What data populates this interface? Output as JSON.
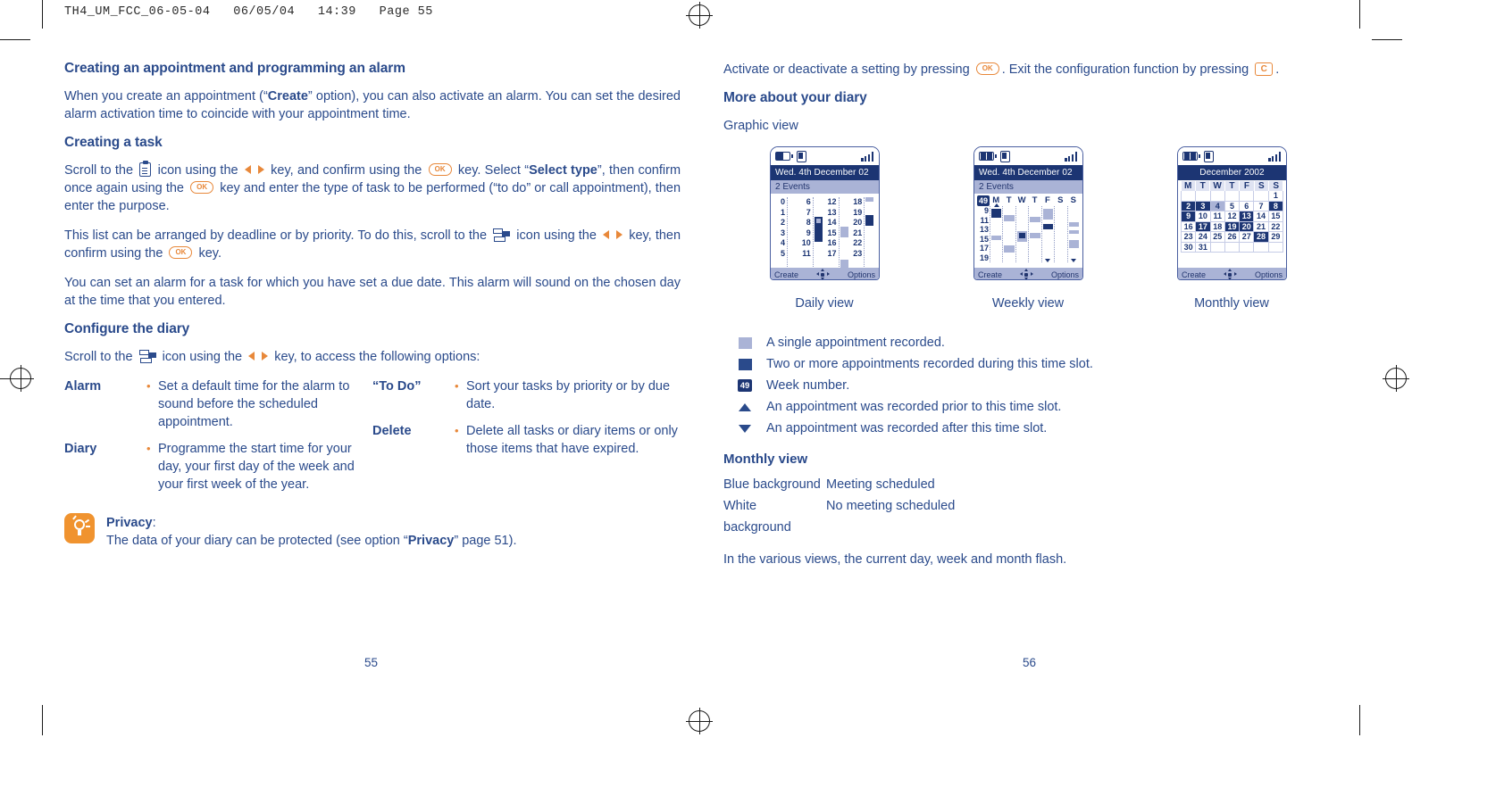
{
  "document_header": "TH4_UM_FCC_06-05-04   06/05/04   14:39   Page 55",
  "colors": {
    "text_blue": "#2a4a8b",
    "accent_orange": "#e8883a",
    "screen_dark": "#1c3573",
    "screen_light": "#aab3d6"
  },
  "left_column": {
    "heading1": "Creating an appointment and programming an alarm",
    "para1_a": "When you create an appointment (“",
    "para1_b": "Create",
    "para1_c": "” option), you can also activate an alarm. You can set the desired alarm activation time to coincide with your appointment time.",
    "heading2": "Creating a task",
    "para2_a": "Scroll to the",
    "para2_b": "icon using the",
    "para2_c": "key, and confirm using the",
    "para2_d": "key. Select “",
    "para2_e": "Select type",
    "para2_f": "”, then confirm once again using the",
    "para2_g": "key and enter the type of task to be performed (“to do” or call appointment), then enter the purpose.",
    "para3_a": "This list can be arranged by deadline or by priority. To do this, scroll to the",
    "para3_b": "icon using the",
    "para3_c": "key, then confirm using the",
    "para3_d": "key.",
    "para4": "You can set an alarm for a task for which you have set a due date. This alarm will sound on the chosen day at the time that you entered.",
    "heading3": "Configure the diary",
    "para5_a": "Scroll to the",
    "para5_b": "icon using the",
    "para5_c": "key, to access the following options:",
    "options": [
      {
        "term": "Alarm",
        "items": [
          "Set a default time for the alarm to sound before the scheduled appointment."
        ]
      },
      {
        "term": "Diary",
        "items": [
          "Programme the start time for your day, your first day of the week and your first week of the year."
        ]
      },
      {
        "term": "“To Do”",
        "items": [
          "Sort your tasks by priority or by due date."
        ]
      },
      {
        "term": "Delete",
        "items": [
          "Delete all tasks or diary items or only those items that have expired."
        ]
      }
    ],
    "note": {
      "title": "Privacy",
      "colon": ":",
      "text_a": "The data of your diary can be protected (see option “",
      "text_b": "Privacy",
      "text_c": "” page 51)."
    },
    "page_number": "55"
  },
  "right_column": {
    "para1_a": "Activate or deactivate a setting by pressing",
    "para1_b": ". Exit the configuration function by pressing",
    "para1_c": ".",
    "heading1": "More about your diary",
    "graphic_view_label": "Graphic view",
    "phones": {
      "daily": {
        "caption": "Daily view",
        "title": "Wed. 4th December 02",
        "subtitle": "2 Events",
        "softkey_left": "Create",
        "softkey_right": "Options",
        "hour_groups": [
          [
            "0",
            "1",
            "2",
            "3",
            "4",
            "5"
          ],
          [
            "6",
            "7",
            "8",
            "9",
            "10",
            "11"
          ],
          [
            "12",
            "13",
            "14",
            "15",
            "16",
            "17"
          ],
          [
            "18",
            "19",
            "20",
            "21",
            "22",
            "23"
          ]
        ]
      },
      "weekly": {
        "caption": "Weekly view",
        "title": "Wed. 4th December 02",
        "subtitle": "2 Events",
        "week_number": "49",
        "day_letters": [
          "M",
          "T",
          "W",
          "T",
          "F",
          "S",
          "S"
        ],
        "hour_labels": [
          "9",
          "11",
          "13",
          "15",
          "17",
          "19"
        ],
        "softkey_left": "Create",
        "softkey_right": "Options"
      },
      "monthly": {
        "caption": "Monthly view",
        "title": "December 2002",
        "day_letters": [
          "M",
          "T",
          "W",
          "T",
          "F",
          "S",
          "S"
        ],
        "weeks": [
          [
            "",
            "",
            "",
            "",
            "",
            "",
            "1"
          ],
          [
            "2",
            "3",
            "4",
            "5",
            "6",
            "7",
            "8"
          ],
          [
            "9",
            "10",
            "11",
            "12",
            "13",
            "14",
            "15"
          ],
          [
            "16",
            "17",
            "18",
            "19",
            "20",
            "21",
            "22"
          ],
          [
            "23",
            "24",
            "25",
            "26",
            "27",
            "28",
            "29"
          ],
          [
            "30",
            "31",
            "",
            "",
            "",
            "",
            ""
          ]
        ],
        "dark_days": [
          "2",
          "3",
          "8",
          "9",
          "13",
          "17",
          "19",
          "20",
          "28"
        ],
        "light_days": [
          "4"
        ],
        "softkey_left": "Create",
        "softkey_right": "Options"
      }
    },
    "legend": [
      {
        "symbol": "light-square",
        "text": "A single appointment recorded."
      },
      {
        "symbol": "dark-square",
        "text": "Two or more appointments recorded during this time slot."
      },
      {
        "symbol": "week-number-badge",
        "label": "49",
        "text": "Week number."
      },
      {
        "symbol": "triangle-up",
        "text": "An appointment was recorded prior to this time slot."
      },
      {
        "symbol": "triangle-down",
        "text": "An appointment was recorded after this time slot."
      }
    ],
    "monthly_heading": "Monthly view",
    "monthly_key": [
      {
        "key": "Blue background",
        "value": "Meeting scheduled"
      },
      {
        "key": "White background",
        "value": "No meeting scheduled"
      }
    ],
    "closing_para": "In the various views, the current day, week and month flash.",
    "page_number": "56"
  }
}
